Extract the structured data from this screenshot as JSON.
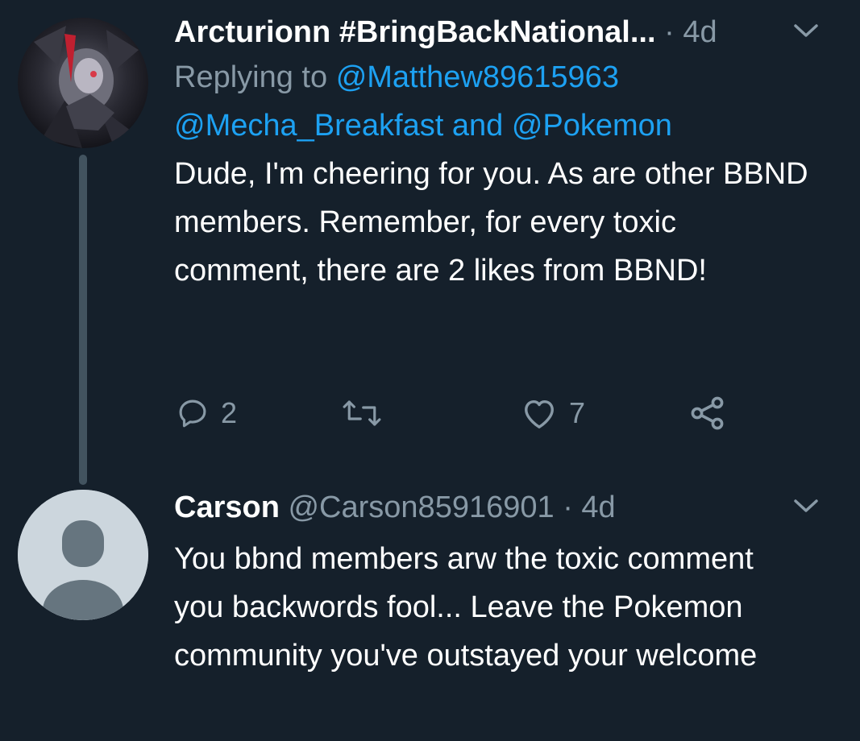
{
  "tweet1": {
    "name": "Arcturionn #BringBackNational...",
    "separator": "·",
    "time": "4d",
    "replying_prefix": "Replying to",
    "replying_user1": "@Matthew89615963",
    "replying_user2": "@Mecha_Breakfast",
    "replying_and": "and",
    "replying_user3": "@Pokemon",
    "text": "Dude, I'm cheering for you. As are other BBND members. Remember, for every toxic comment, there are 2 likes from BBND!",
    "reply_count": "2",
    "like_count": "7"
  },
  "tweet2": {
    "name": "Carson",
    "handle": "@Carson85916901",
    "separator": "·",
    "time": "4d",
    "text": "You bbnd members arw the toxic comment you backwords fool... Leave the Pokemon community you've outstayed your welcome"
  },
  "colors": {
    "background": "#15202b",
    "muted": "#8899a6",
    "link": "#1da1f2",
    "thread_line": "#42535f",
    "default_avatar_bg": "#ccd6dd",
    "default_avatar_fg": "#66757f"
  }
}
